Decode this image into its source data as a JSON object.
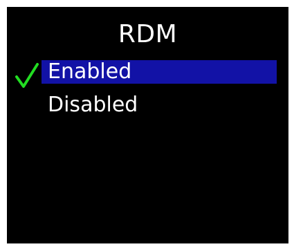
{
  "screen": {
    "title": "RDM"
  },
  "menu": {
    "items": [
      {
        "label": "Enabled",
        "selected": true,
        "checked": true
      },
      {
        "label": "Disabled",
        "selected": false,
        "checked": false
      }
    ]
  },
  "icons": {
    "checkmark": "check-icon"
  },
  "colors": {
    "background": "#000000",
    "text": "#ffffff",
    "highlight": "#1212a6",
    "check": "#22dd22"
  }
}
